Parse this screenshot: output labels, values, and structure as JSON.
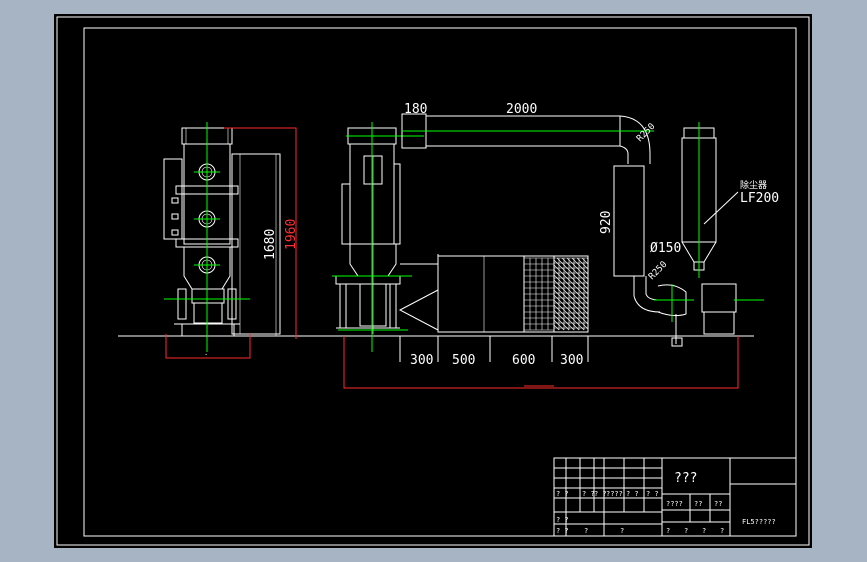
{
  "drawing": {
    "dimensions": {
      "d180": "180",
      "d2000": "2000",
      "r250_top": "R250",
      "r250_bottom": "R250",
      "d920": "920",
      "d150": "Ø150",
      "d1680": "1680",
      "d1960": "1960",
      "d300a": "300",
      "d500": "500",
      "d600": "600",
      "d300b": "300"
    },
    "callout": {
      "line1": "除尘器",
      "line2": "LF200"
    }
  },
  "title_block": {
    "title": "???",
    "r2c1": "? ?",
    "r2c2": "? ?",
    "r2c3": "? ?",
    "r2c4": "????",
    "r2c5": "? ?",
    "r2c6": "? ?",
    "mid1": "????",
    "mid2": "??",
    "mid3": "??",
    "bot_a": "?",
    "bot_b": "?",
    "bot_c": "?",
    "bot_d": "?",
    "bot_e": "?",
    "bot_f": "?",
    "sc1": "? ?",
    "sc2": "? ?",
    "code": "FL5?????"
  }
}
